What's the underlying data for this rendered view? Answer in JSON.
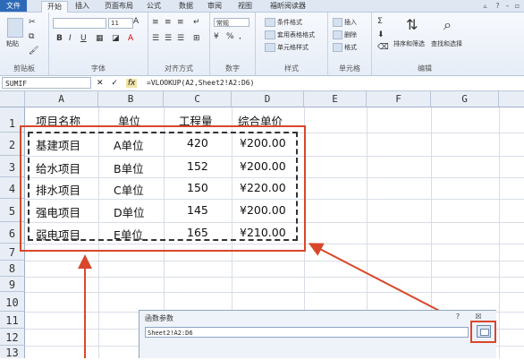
{
  "ribbon_tabs": [
    "文件",
    "开始",
    "插入",
    "页面布局",
    "公式",
    "数据",
    "审阅",
    "视图",
    "福昕阅读器"
  ],
  "ribbon": {
    "paste_label": "粘贴",
    "clipboard_label": "剪贴板",
    "font_group_label": "字体",
    "font_size": "11",
    "bold": "B",
    "italic": "I",
    "underline": "U",
    "font_color_glyph": "A",
    "align_group_label": "对齐方式",
    "number_format": "常规",
    "percent": "%",
    "number_group_label": "数字",
    "cond_format": "条件格式",
    "table_format": "套用表格格式",
    "cell_style": "单元格样式",
    "styles_group_label": "样式",
    "insert": "插入",
    "delete": "删除",
    "format": "格式",
    "cells_group_label": "单元格",
    "sigma": "Σ",
    "sort_filter": "排序和筛选",
    "find_select": "查找和选择",
    "editing_group_label": "编辑"
  },
  "formula_bar": {
    "name_box": "SUMIF",
    "cancel": "✕",
    "enter": "✓",
    "fx": "fx",
    "formula": "=VLOOKUP(A2,Sheet2!A2:D6)"
  },
  "grid": {
    "columns": [
      "A",
      "B",
      "C",
      "D",
      "E",
      "F",
      "G"
    ],
    "rows": [
      "1",
      "2",
      "3",
      "4",
      "5",
      "6",
      "7",
      "8",
      "9",
      "10",
      "11",
      "12",
      "13"
    ],
    "headers": [
      "项目名称",
      "单位",
      "工程量",
      "综合单价"
    ],
    "data": [
      [
        "基建项目",
        "A单位",
        "420",
        "¥200.00"
      ],
      [
        "给水项目",
        "B单位",
        "152",
        "¥200.00"
      ],
      [
        "排水项目",
        "C单位",
        "150",
        "¥220.00"
      ],
      [
        "强电项目",
        "D单位",
        "145",
        "¥200.00"
      ],
      [
        "弱电项目",
        "E单位",
        "165",
        "¥210.00"
      ]
    ]
  },
  "dialog": {
    "title": "函数参数",
    "help": "?",
    "close": "☒",
    "value": "Sheet2!A2:D6"
  },
  "colors": {
    "annotation": "#d9472b",
    "file_tab": "#2c6ab7",
    "header_bg": "#e9eef6"
  }
}
